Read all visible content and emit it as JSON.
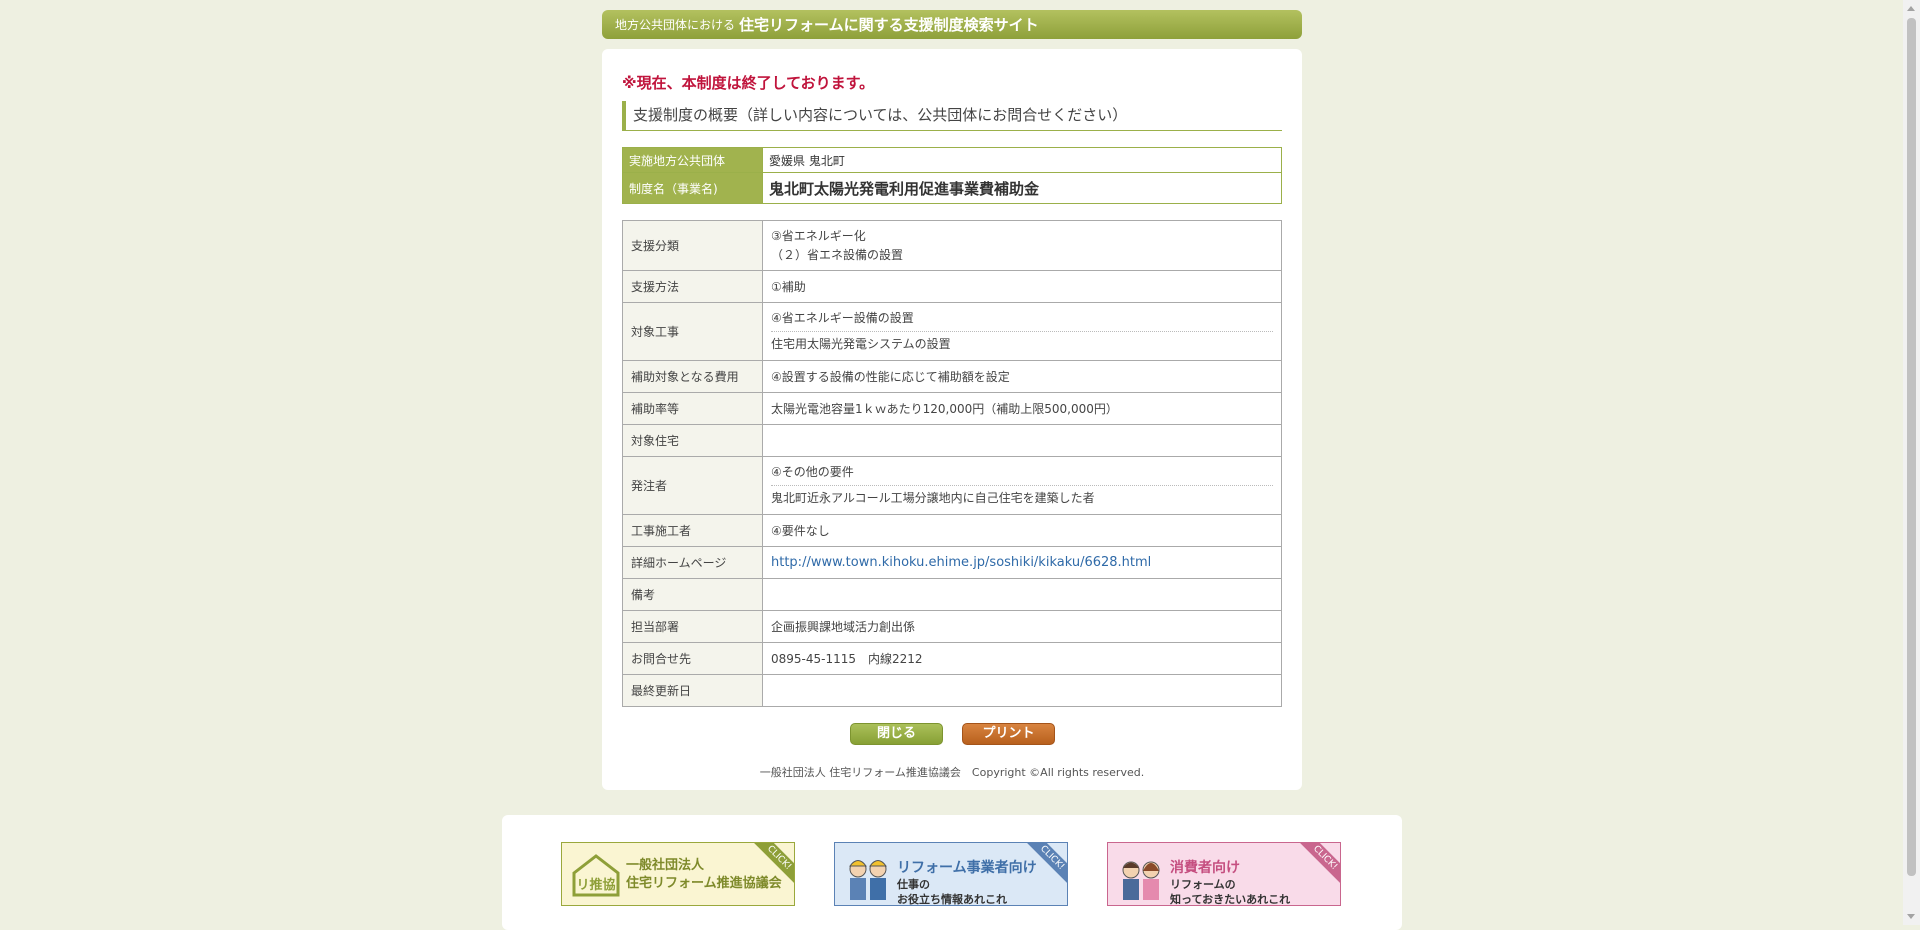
{
  "header": {
    "small": "地方公共団体における",
    "title": "住宅リフォームに関する支援制度検索サイト"
  },
  "notice": "※現在、本制度は終了しております。",
  "section_title": "支援制度の概要（詳しい内容については、公共団体にお問合せください）",
  "summary": {
    "org_label": "実施地方公共団体",
    "org_value": "愛媛県 鬼北町",
    "name_label": "制度名（事業名)",
    "name_value": "鬼北町太陽光発電利用促進事業費補助金"
  },
  "details": {
    "support_category": {
      "label": "支援分類",
      "line1": "③省エネルギー化",
      "line2": "（２）省エネ設備の設置"
    },
    "support_method": {
      "label": "支援方法",
      "value": "①補助"
    },
    "target_work": {
      "label": "対象工事",
      "line1": "④省エネルギー設備の設置",
      "line2": "住宅用太陽光発電システムの設置"
    },
    "eligible_cost": {
      "label": "補助対象となる費用",
      "value": "④設置する設備の性能に応じて補助額を設定"
    },
    "subsidy_rate": {
      "label": "補助率等",
      "value": "太陽光電池容量1ｋｗあたり120,000円（補助上限500,000円）"
    },
    "target_housing": {
      "label": "対象住宅",
      "value": ""
    },
    "orderer": {
      "label": "発注者",
      "line1": "④その他の要件",
      "line2": "鬼北町近永アルコール工場分譲地内に自己住宅を建築した者"
    },
    "contractor": {
      "label": "工事施工者",
      "value": "④要件なし"
    },
    "homepage": {
      "label": "詳細ホームページ",
      "url": "http://www.town.kihoku.ehime.jp/soshiki/kikaku/6628.html"
    },
    "remarks": {
      "label": "備考",
      "value": ""
    },
    "department": {
      "label": "担当部署",
      "value": "企画振興課地域活力創出係"
    },
    "contact": {
      "label": "お問合せ先",
      "value": "0895-45-1115　内線2212"
    },
    "last_updated": {
      "label": "最終更新日",
      "value": ""
    }
  },
  "buttons": {
    "close": "閉じる",
    "print": "プリント"
  },
  "copyright": "一般社団法人 住宅リフォーム推進協議会　Copyright ©All rights reserved.",
  "banners": {
    "association": {
      "line1": "一般社団法人",
      "line2": "住宅リフォーム推進協議会",
      "badge": "CLICK!",
      "logo": "リ推協"
    },
    "business": {
      "title": "リフォーム事業者向け",
      "line1": "仕事の",
      "line2": "お役立ち情報あれこれ",
      "badge": "CLICK!"
    },
    "consumer": {
      "title": "消費者向け",
      "line1": "リフォームの",
      "line2": "知っておきたいあれこれ",
      "badge": "CLICK!"
    }
  },
  "colors": {
    "accent_green": "#9bb04a",
    "notice_red": "#c0143c",
    "print_orange": "#c56a24",
    "link_blue": "#2f6aa8"
  }
}
